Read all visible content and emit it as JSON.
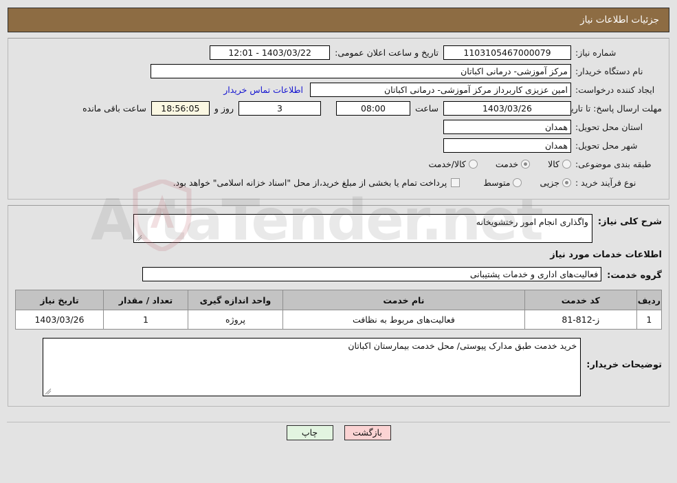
{
  "header": {
    "title": "جزئیات اطلاعات نیاز"
  },
  "top_section": {
    "need_number_label": "شماره نیاز:",
    "need_number_value": "1103105467000079",
    "announce_datetime_label": "تاریخ و ساعت اعلان عمومی:",
    "announce_datetime_value": "1403/03/22 - 12:01",
    "buyer_org_label": "نام دستگاه خریدار:",
    "buyer_org_value": "مرکز آموزشی- درمانی اکباتان",
    "creator_label": "ایجاد کننده درخواست:",
    "creator_value": "امین عزیزی کاربرداز مرکز آموزشی- درمانی اکباتان",
    "contact_link": "اطلاعات تماس خریدار",
    "deadline_label": "مهلت ارسال پاسخ: تا تاریخ:",
    "deadline_date": "1403/03/26",
    "hour_label": "ساعت",
    "deadline_time": "08:00",
    "days_remaining": "3",
    "days_sep_label": "روز و",
    "time_remaining": "18:56:05",
    "remaining_suffix_label": "ساعت باقی مانده",
    "province_label": "استان محل تحویل:",
    "province_value": "همدان",
    "city_label": "شهر محل تحویل:",
    "city_value": "همدان",
    "category_label": "طبقه بندی موضوعی:",
    "category_options": [
      {
        "label": "کالا",
        "selected": false
      },
      {
        "label": "خدمت",
        "selected": true
      },
      {
        "label": "کالا/خدمت",
        "selected": false
      }
    ],
    "process_label": "نوع فرآیند خرید :",
    "process_options": [
      {
        "label": "جزیی",
        "selected": true
      },
      {
        "label": "متوسط",
        "selected": false
      }
    ],
    "treasury_checkbox_label": "پرداخت تمام یا بخشی از مبلغ خرید،از محل \"اسناد خزانه اسلامی\" خواهد بود.",
    "treasury_checked": false
  },
  "middle_section": {
    "general_desc_label": "شرح کلی نیاز:",
    "general_desc_value": "واگذاری انجام امور رختشویخانه",
    "services_section_title": "اطلاعات خدمات مورد نیاز",
    "service_group_label": "گروه خدمت:",
    "service_group_value": "فعالیت‌های اداری و خدمات پشتیبانی",
    "table": {
      "headers": [
        "ردیف",
        "کد خدمت",
        "نام خدمت",
        "واحد اندازه گیری",
        "تعداد / مقدار",
        "تاریخ نیاز"
      ],
      "rows": [
        {
          "radif": "1",
          "code": "ز-812-81",
          "name": "فعالیت‌های مربوط به نظافت",
          "unit": "پروژه",
          "qty": "1",
          "date": "1403/03/26"
        }
      ]
    },
    "buyer_notes_label": "توضیحات خریدار:",
    "buyer_notes_value": "خرید خدمت طبق مدارک پیوستی/ محل خدمت بیمارستان اکباتان"
  },
  "footer": {
    "print_button": "چاپ",
    "back_button": "بازگشت"
  },
  "watermark": {
    "text": "ArtaTender.net"
  },
  "colors": {
    "header_bg": "#8d6c43",
    "page_bg": "#e3e3e3",
    "link": "#1414d0",
    "table_header_bg": "#c3c3c3",
    "back_button_bg": "#fbd3d3",
    "print_button_bg": "#e2f4e0",
    "countdown_bg": "#fbf8e3"
  }
}
